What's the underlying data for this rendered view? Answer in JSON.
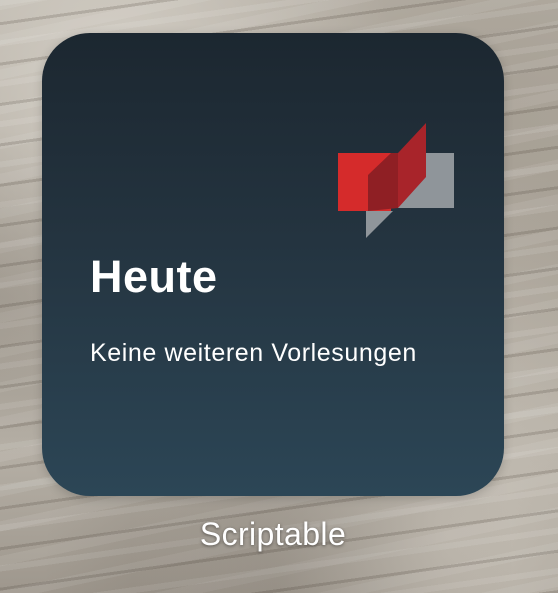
{
  "widget": {
    "title": "Heute",
    "message": "Keine weiteren Vorlesungen",
    "logo_icon": "hochschule-logo-icon",
    "background_top": "#1c2730",
    "background_bottom": "#2c4656"
  },
  "app": {
    "label": "Scriptable"
  },
  "colors": {
    "logo_red": "#d52b2b",
    "logo_dark_red": "#8f1f24",
    "logo_gray": "#8f959a",
    "text": "#ffffff"
  }
}
